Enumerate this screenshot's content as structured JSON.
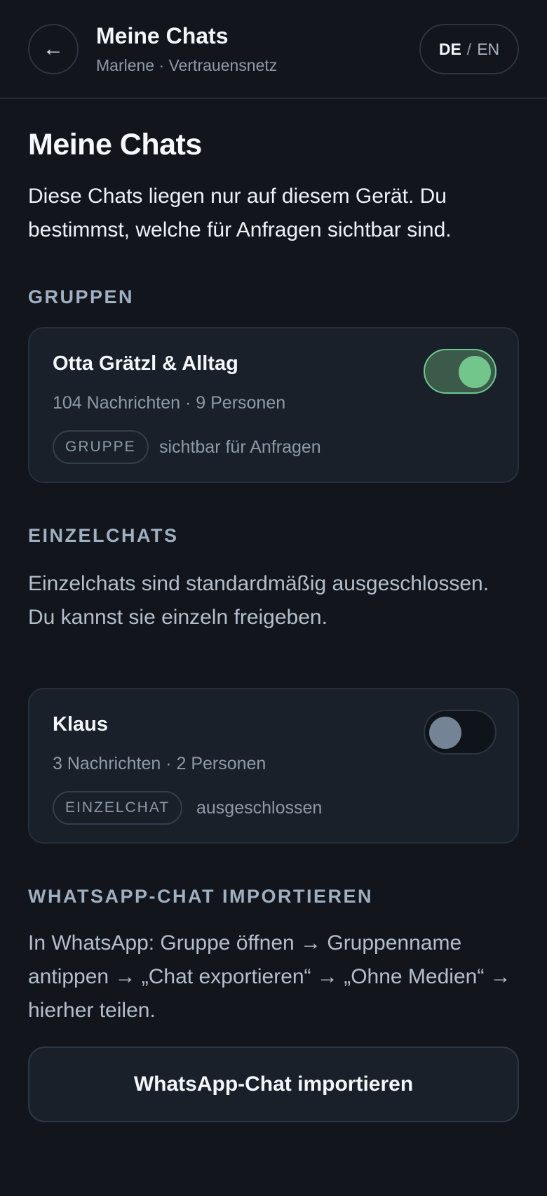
{
  "header": {
    "back_icon": "arrow-left-icon",
    "back_glyph": "←",
    "title": "Meine Chats",
    "subtitle": "Marlene · Vertrauensnetz",
    "lang_active": "DE",
    "lang_separator": "/",
    "lang_other": "EN"
  },
  "page": {
    "title": "Meine Chats",
    "intro": "Diese Chats liegen nur auf diesem Gerät. Du bestimmst, welche für Anfragen sichtbar sind."
  },
  "groups": {
    "label": "GRUPPEN",
    "items": [
      {
        "name": "Otta Grätzl & Alltag",
        "meta": "104 Nachrichten · 9 Personen",
        "badge": "GRUPPE",
        "status": "sichtbar für Anfragen",
        "enabled": true
      }
    ]
  },
  "single": {
    "label": "EINZELCHATS",
    "description": "Einzelchats sind standardmäßig ausgeschlossen. Du kannst sie einzeln freigeben.",
    "items": [
      {
        "name": "Klaus",
        "meta": "3 Nachrichten · 2 Personen",
        "badge": "EINZELCHAT",
        "status": "ausgeschlossen",
        "enabled": false
      }
    ]
  },
  "import": {
    "label": "WHATSAPP-CHAT IMPORTIEREN",
    "instructions": "In WhatsApp: Gruppe öffnen → Gruppenname antippen → „Chat exportieren“ → „Ohne Medien“ → hierher teilen.",
    "button_label": "WhatsApp-Chat importieren"
  },
  "colors": {
    "background": "#12161c",
    "card": "#1a2029",
    "accent_green": "#72c68b",
    "muted_text": "#8e9aa8"
  }
}
